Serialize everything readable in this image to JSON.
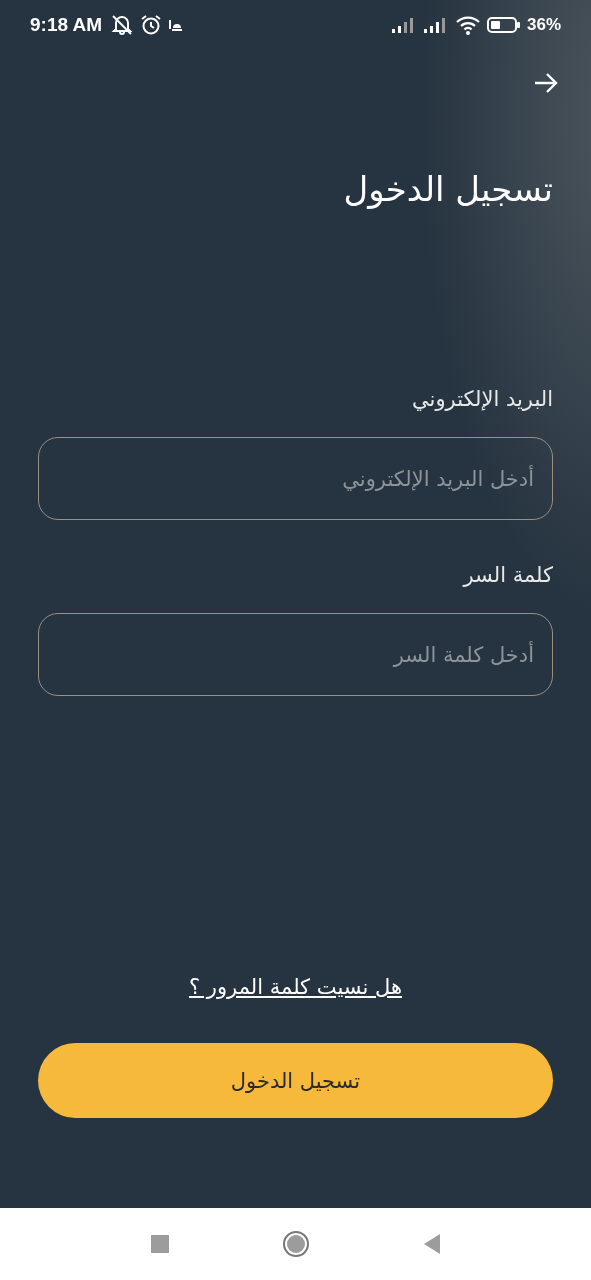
{
  "status_bar": {
    "time": "9:18 AM",
    "battery_percent": "36%"
  },
  "title": "تسجيل الدخول",
  "fields": [
    {
      "label": "البريد الإلكتروني",
      "placeholder": "أدخل البريد الإلكتروني"
    },
    {
      "label": "كلمة السر",
      "placeholder": "أدخل كلمة السر"
    }
  ],
  "forgot_link": "هل نسيت كلمة المرور ؟",
  "submit_button": "تسجيل الدخول"
}
